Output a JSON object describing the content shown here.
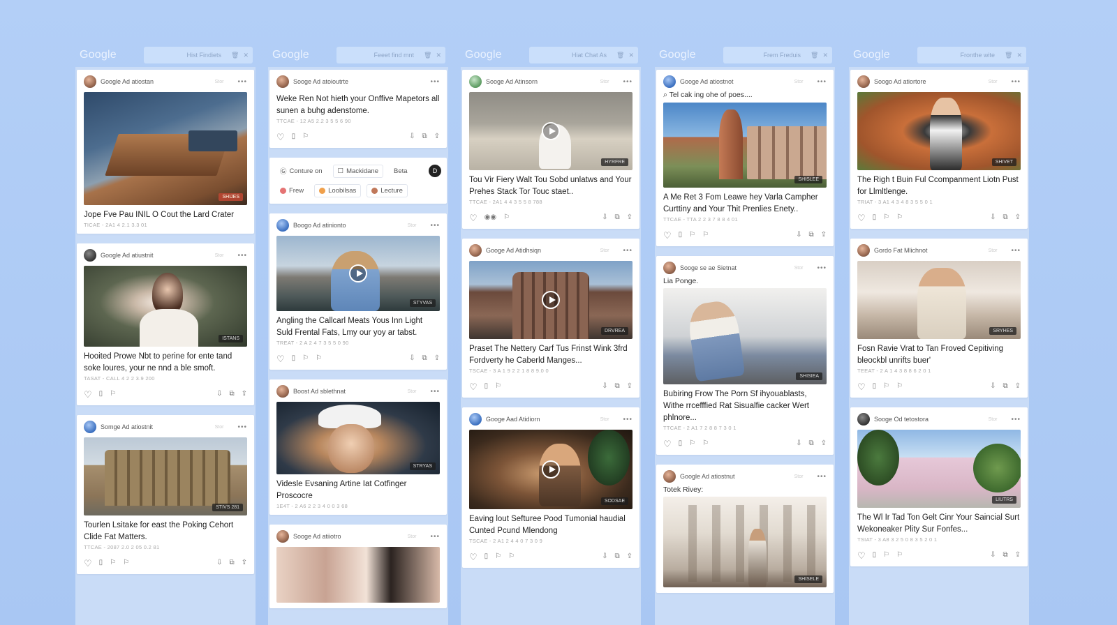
{
  "columns": [
    {
      "logo": "Google",
      "search": "Hist Findiets",
      "cards": [
        {
          "advertiser": "Google Ad atiostan",
          "scene": "office",
          "badge": "SHIJES",
          "badge_red": true,
          "title": "Jope Fve Pau INIL O Cout the Lard Crater",
          "date": "TICAE - 2A1 4 2.1 3.3 01"
        },
        {
          "advertiser": "Google Ad atiustnit",
          "scene": "woman1",
          "badge": "ISTANS",
          "title": "Hooited Prowe Nbt to perine for ente tand soke loures, your ne nnd a ble smoft.",
          "date": "TASAT - CALL 4 2 2 3.9 200"
        },
        {
          "advertiser": "Somge Ad atiostnit",
          "scene": "building1",
          "badge": "STIVS 281",
          "title": "Tourlen Lsitake for east the Poking Cehort Clide Fat Matters.",
          "date": "TTCAE - 2087 2.0 2 05 0.2 81"
        }
      ]
    },
    {
      "logo": "Google",
      "search": "Feeet find mnt",
      "cards_top": {
        "advertiser": "Sooge Ad atoioutrte",
        "title": "Weke Ren Not hieth your Onffive Mapetors all sunen a buhg adenstome.",
        "date": "TTCAE - 12 A5 2.2 3 5 5 6 90"
      },
      "chips": {
        "row1": [
          "Conture on",
          "Mackidane",
          "Beta"
        ],
        "dark_label": "D",
        "row2": [
          "Frew",
          "Loobilsas",
          "Lecture"
        ]
      },
      "cards": [
        {
          "advertiser": "Boogo Ad atinionto",
          "scene": "mountain",
          "badge": "STYVAS",
          "title": "Angling the Callcarl Meats Yous Inn Light Suld Frental Fats, Lmy our yoy ar tabst.",
          "date": "TREAT - 2 A 2 4 7 3 5 5 0 90"
        },
        {
          "advertiser": "Boost Ad sblethnat",
          "scene": "hat",
          "badge": "STRYAS",
          "title": "Videsle Evsaning Artine Iat Cotfinger Proscocre",
          "date": "1E4T - 2 A6 2 2 3 4 0 0 3 68"
        },
        {
          "advertiser": "Sooge Ad atiiotro",
          "scene": "curtain",
          "badge": "",
          "title": "",
          "date": ""
        }
      ]
    },
    {
      "logo": "Google",
      "search": "Hiat Chat As",
      "cards": [
        {
          "advertiser": "Sooge Ad Atinsorn",
          "scene": "rooftop",
          "badge": "HYRFRE",
          "play": true,
          "title": "Tou Vir Fiery Walt Tou Sobd unlatws and Your Prehes Stack Tor Touc staet..",
          "date": "TTCAE - 2A1 4 4 3 5 5 8 788"
        },
        {
          "advertiser": "Googe Ad Atidhsiqn",
          "scene": "church",
          "badge": "DRVREA",
          "play": true,
          "title": "Praset The Nettery Carf Tus Frinst Wink 3frd Fordverty he Caberld Manges...",
          "date": "TSCAE - 3 A 1 9 2 2 1 8 8 9.0 0"
        },
        {
          "advertiser": "Googe Aad Atidiorn",
          "scene": "cafe",
          "badge": "SODSAE",
          "play": true,
          "title": "Eaving lout Sefturee Pood Tumonial haudial Cunted Pcund Mlendong",
          "date": "TSCAE - 2 A1 2 4 4 0 7 3 0 9"
        }
      ]
    },
    {
      "logo": "Google",
      "search": "Frem Freduis",
      "cards": [
        {
          "advertiser": "Googe Ad atiostnot",
          "snippet": "Tel cak ing ohe of poes....",
          "scene": "tower",
          "badge": "SHISLEE",
          "title": "A Me Ret 3 Fom Leawe hey Varla Campher Curttiny and Your Thit Prenlies Enety..",
          "date": "TTCAE - TTA 2 2 3 7 8 8 4 01"
        },
        {
          "advertiser": "Sooge se ae Sietnat",
          "snippet": "Lia Ponge.",
          "scene": "sitting",
          "badge": "SHISIEA",
          "title": "Bubiring Frow The Porn Sf ihyouablasts, Withe rrcefffied Rat Sisualfie cacker Wert phlnore...",
          "date": "TTCAE - 2 A1 7 2 8 8 7 3 0 1"
        },
        {
          "advertiser": "Google Ad atiostnut",
          "snippet": "Totek Rivey:",
          "scene": "street",
          "badge": "SHISELE",
          "title": "",
          "date": ""
        }
      ]
    },
    {
      "logo": "Google",
      "search": "Fronthe wite",
      "cards": [
        {
          "advertiser": "Soogo Ad atiortore",
          "scene": "plants",
          "badge": "SHIVET",
          "title": "The Righ t Buin Ful Ccompanment Liotn Pust for Llmltlenge.",
          "date": "TRIAT - 3 A1 4 3 4 8 3 5 5 0 1"
        },
        {
          "advertiser": "Gordo Fat Mlichnot",
          "scene": "coat",
          "badge": "SRYHES",
          "title": "Fosn Ravie Vrat to Tan Froved Cepitiving bleockbl unrifts buer'",
          "date": "TEEAT - 2 A 1 4 3 8 8 6 2 0 1"
        },
        {
          "advertiser": "Sooge Od tetostora",
          "scene": "pink",
          "badge": "LIUTRS",
          "title": "The Wl Ir Tad Ton Gelt Cinr Your Saincial Surt Wekoneaker Plity Sur Fonfes...",
          "date": "TSIAT - 3 A8 3 2 5 0 8 3 5 2 0 1"
        }
      ]
    }
  ]
}
